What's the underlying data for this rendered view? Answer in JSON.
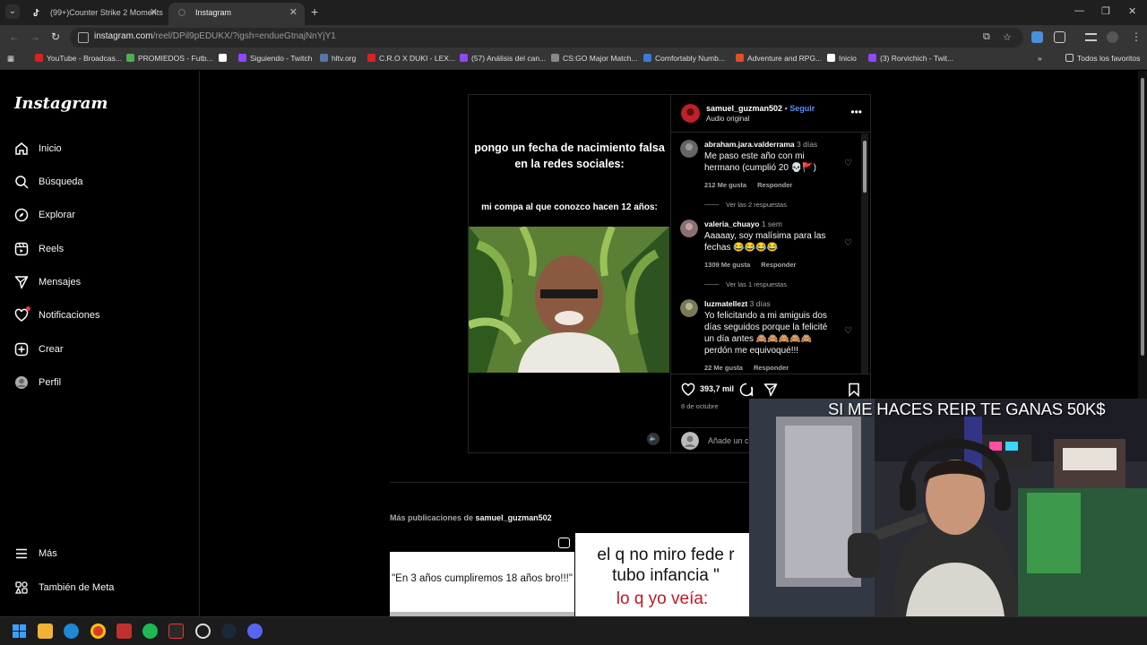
{
  "browser": {
    "tabs": [
      {
        "title": "(99+)Counter Strike 2 Moments",
        "active": false
      },
      {
        "title": "Instagram",
        "active": true
      }
    ],
    "url_host": "instagram.com",
    "url_path": "/reel/DPil9pEDUKX/?igsh=endueGtnajNnYjY1",
    "bookmarks": [
      "YouTube - Broadcas...",
      "PROMIEDOS - Futb...",
      "Siguiendo - Twitch",
      "hltv.org",
      "C.R.O X DUKI - LEX...",
      "(57) Análisis del can...",
      "CS:GO Major Match...",
      "Comfortably Numb...",
      "Adventure and RPG...",
      "Inicio",
      "(3) Rorvichich - Twit..."
    ],
    "all_bookmarks": "Todos los favoritos"
  },
  "sidebar": {
    "logo": "Instagram",
    "items": [
      {
        "label": "Inicio",
        "icon": "home-icon"
      },
      {
        "label": "Búsqueda",
        "icon": "search-icon"
      },
      {
        "label": "Explorar",
        "icon": "compass-icon"
      },
      {
        "label": "Reels",
        "icon": "reels-icon"
      },
      {
        "label": "Mensajes",
        "icon": "send-icon"
      },
      {
        "label": "Notificaciones",
        "icon": "heart-icon"
      },
      {
        "label": "Crear",
        "icon": "plus-square-icon"
      },
      {
        "label": "Perfil",
        "icon": "avatar-icon"
      }
    ],
    "more": "Más",
    "meta": "También de Meta"
  },
  "post": {
    "caption_main": "pongo un fecha de nacimiento falsa en la redes sociales:",
    "caption_sub": "mi compa al que conozco hacen 12 años:",
    "username": "samuel_guzman502",
    "separator": "•",
    "follow": "Seguir",
    "audio": "Audio original",
    "comments": [
      {
        "user": "abraham.jara.valderrama",
        "time": "3 días",
        "text": "Me paso este año con mi hermano (cumplió 20 💀🚩)",
        "likes": "212 Me gusta",
        "reply": "Responder",
        "replies": "Ver las 2 respuestas"
      },
      {
        "user": "valeria_chuayo",
        "time": "1 sem",
        "text": "Aaaaay, soy malísima para las fechas 😂😂😂😂",
        "likes": "1309 Me gusta",
        "reply": "Responder",
        "replies": "Ver las 1 respuestas"
      },
      {
        "user": "luzmatellezt",
        "time": "3 días",
        "text": "Yo felicitando a mi amiguis dos días seguidos porque la felicité un día antes 🙈🙈🙈🙈🙈 perdón me equivoqué!!!",
        "likes": "22 Me gusta",
        "reply": "Responder"
      }
    ],
    "like_count": "393,7 mil",
    "date": "8 de octubre",
    "add_comment": "Añade un co"
  },
  "more_posts": {
    "prefix": "Más publicaciones de",
    "user": "samuel_guzman502",
    "thumb1_text": "\"En 3 años cumpliremos 18 años bro!!!\"",
    "thumb2_line1": "el q no miro fede r",
    "thumb2_line2": "tubo infancia \"",
    "thumb2_line3": "lo q yo veía:"
  },
  "overlay": {
    "title": "SI ME HACES REIR TE GANAS 50K$"
  },
  "colors": {
    "accent_follow": "#5b8dff",
    "notification_dot": "#ff3040"
  }
}
